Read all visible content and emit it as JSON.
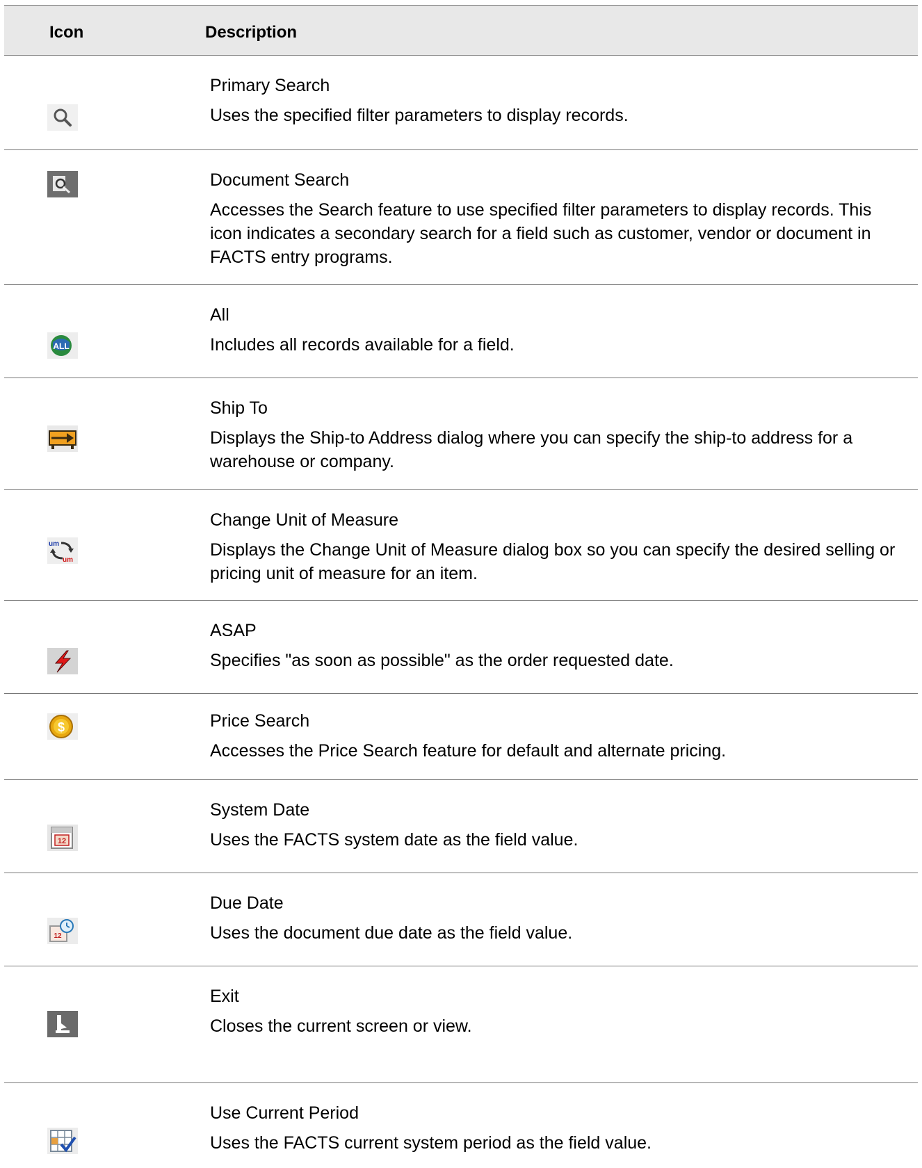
{
  "table": {
    "headers": {
      "icon": "Icon",
      "description": "Description"
    },
    "rows": [
      {
        "icon": "magnifier-search-icon",
        "title": "Primary Search",
        "description": "Uses the specified filter parameters to display records."
      },
      {
        "icon": "document-search-icon",
        "title": "Document Search",
        "description": "Accesses the Search feature to use specified filter parameters to display records. This icon indicates a secondary search for a field such as customer, vendor or document in FACTS entry programs."
      },
      {
        "icon": "all-globe-icon",
        "title": "All",
        "description": "Includes all records available for a field."
      },
      {
        "icon": "ship-to-truck-icon",
        "title": "Ship To",
        "description": "Displays the Ship-to Address dialog where you can specify the ship-to address for a warehouse or company."
      },
      {
        "icon": "change-unit-of-measure-icon",
        "title": "Change Unit of Measure",
        "description": "Displays the Change Unit of Measure dialog box so you can specify the desired selling or pricing unit of measure for an item."
      },
      {
        "icon": "asap-lightning-icon",
        "title": "ASAP",
        "description": "Specifies \"as soon as possible\" as the order requested date."
      },
      {
        "icon": "price-search-coin-icon",
        "title": "Price Search",
        "description": "Accesses the Price Search feature for default and alternate pricing."
      },
      {
        "icon": "system-date-calendar-icon",
        "title": "System Date",
        "description": "Uses the FACTS system date as the field value."
      },
      {
        "icon": "due-date-calendar-clock-icon",
        "title": "Due Date",
        "description": "Uses the document due date as the field value."
      },
      {
        "icon": "exit-door-icon",
        "title": "Exit",
        "description": "Closes the current screen or view."
      },
      {
        "icon": "use-current-period-icon",
        "title": "Use Current Period",
        "description": "Uses the FACTS current system period as the field value."
      }
    ]
  }
}
